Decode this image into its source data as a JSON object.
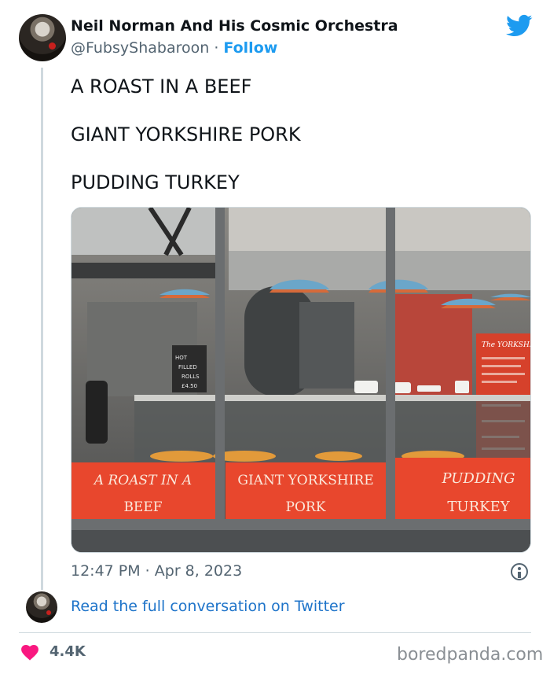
{
  "author": {
    "name": "Neil Norman And His Cosmic Orchestra",
    "handle": "@FubsyShabaroon",
    "separator": " · ",
    "follow_label": "Follow"
  },
  "tweet": {
    "lines": [
      "A ROAST IN A BEEF",
      "GIANT YORKSHIRE PORK",
      "PUDDING TURKEY"
    ],
    "timestamp": "12:47 PM · Apr 8, 2023"
  },
  "photo": {
    "signs": [
      {
        "line1": "A ROAST IN A",
        "line2": "BEEF"
      },
      {
        "line1": "GIANT YORKSHIRE",
        "line2": "PORK"
      },
      {
        "line1": "PUDDING",
        "line2": "TURKEY"
      }
    ],
    "chalkboard": [
      "HOT",
      "FILLED",
      "ROLLS",
      "£4.50"
    ],
    "menu_board_title": "The YORKSHIR",
    "colors": {
      "sign": "#e8472d",
      "sign_text": "#fbe9dc",
      "frame": "#6b6e70"
    }
  },
  "footer": {
    "read_more": "Read the full conversation on Twitter",
    "likes": "4.4K",
    "watermark": "boredpanda.com"
  },
  "colors": {
    "accent": "#1d9bf0",
    "heart": "#f91880",
    "muted": "#536471"
  },
  "icons": {
    "logo": "twitter-bird-icon",
    "info": "info-icon",
    "like": "heart-icon"
  }
}
